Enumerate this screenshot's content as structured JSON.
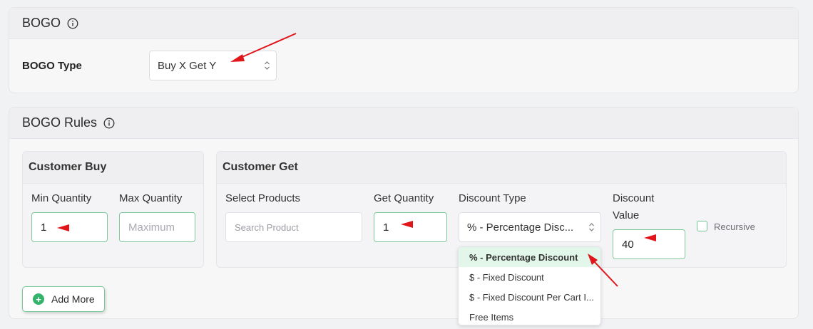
{
  "bogo_section": {
    "title": "BOGO",
    "type_label": "BOGO Type",
    "type_value": "Buy X Get Y"
  },
  "rules_section": {
    "title": "BOGO Rules",
    "customer_buy": {
      "title": "Customer Buy",
      "min_label": "Min Quantity",
      "min_value": "1",
      "max_label": "Max Quantity",
      "max_placeholder": "Maximum"
    },
    "customer_get": {
      "title": "Customer Get",
      "products_label": "Select Products",
      "products_placeholder": "Search Product",
      "get_qty_label": "Get Quantity",
      "get_qty_value": "1",
      "discount_type_label": "Discount Type",
      "discount_type_value": "% - Percentage Disc...",
      "discount_value_label_line1": "Discount",
      "discount_value_label_line2": "Value",
      "discount_value": "40",
      "recursive_label": "Recursive"
    },
    "add_more_label": "Add More"
  },
  "discount_dropdown": {
    "options": [
      "% - Percentage Discount",
      "$ - Fixed Discount",
      "$ - Fixed Discount Per Cart I...",
      "Free Items"
    ],
    "selected": "% - Percentage Discount"
  },
  "colors": {
    "accent_green": "#34b36a",
    "input_border": "#7ec99b",
    "annotation_red": "#e0161b",
    "selected_option_bg": "#e3f6ea"
  },
  "icons": [
    "info-icon",
    "updown-arrows-icon",
    "plus-circle-icon",
    "annotation-arrow"
  ]
}
